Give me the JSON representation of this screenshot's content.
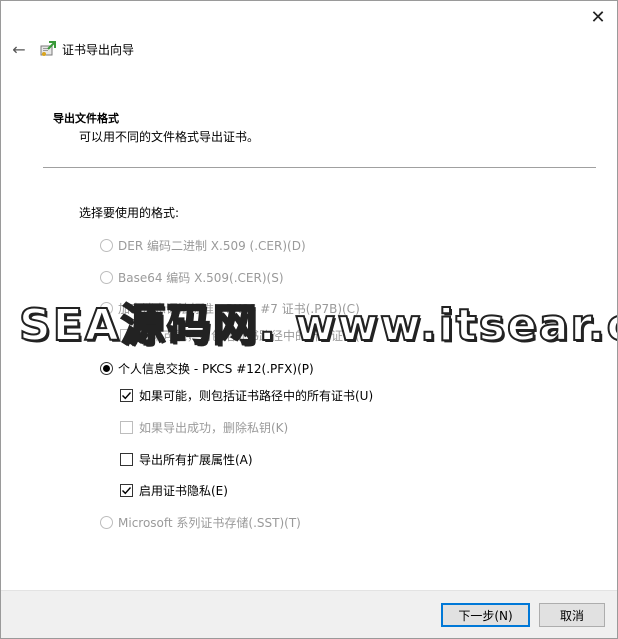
{
  "window": {
    "close_glyph": "✕"
  },
  "header": {
    "back_glyph": "←",
    "title": "证书导出向导"
  },
  "section": {
    "heading": "导出文件格式",
    "description": "可以用不同的文件格式导出证书。"
  },
  "format": {
    "label": "选择要使用的格式:",
    "options": [
      {
        "label": "DER 编码二进制 X.509 (.CER)(D)",
        "selected": false,
        "enabled": false
      },
      {
        "label": "Base64 编码 X.509(.CER)(S)",
        "selected": false,
        "enabled": false
      },
      {
        "label": "加密消息语法标准 - PKCS #7 证书(.P7B)(C)",
        "selected": false,
        "enabled": false
      },
      {
        "label": "如果可能，则包括证书路径中的所有证书(I)",
        "checked": false,
        "enabled": false
      },
      {
        "label": "个人信息交换 - PKCS #12(.PFX)(P)",
        "selected": true,
        "enabled": true
      },
      {
        "label": "如果可能，则包括证书路径中的所有证书(U)",
        "checked": true,
        "enabled": true
      },
      {
        "label": "如果导出成功，删除私钥(K)",
        "checked": false,
        "enabled": false
      },
      {
        "label": "导出所有扩展属性(A)",
        "checked": false,
        "enabled": true
      },
      {
        "label": "启用证书隐私(E)",
        "checked": true,
        "enabled": true
      },
      {
        "label": "Microsoft 系列证书存储(.SST)(T)",
        "selected": false,
        "enabled": false
      }
    ]
  },
  "watermark": {
    "text": "SEA源码网. www.itsear.com"
  },
  "footer": {
    "next_label": "下一步(N)",
    "cancel_label": "取消"
  },
  "colors": {
    "accent": "#0078d7",
    "disabled_text": "#9a9a9a",
    "footer_bg": "#f0f0f0"
  }
}
